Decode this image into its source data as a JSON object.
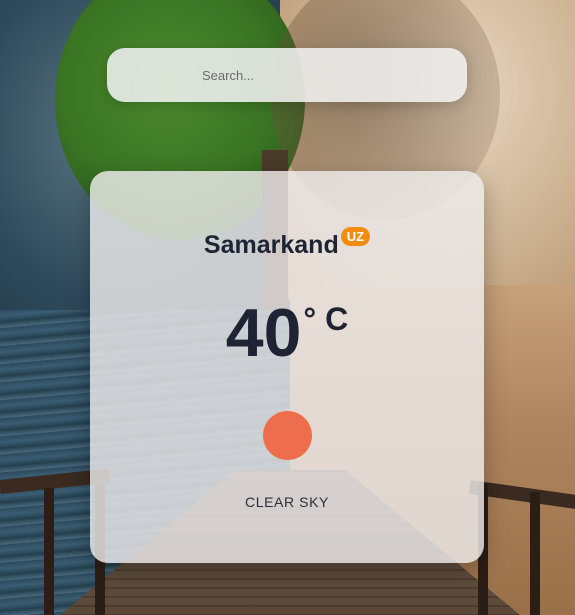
{
  "search": {
    "placeholder": "Search..."
  },
  "weather": {
    "city": "Samarkand",
    "country": "UZ",
    "temperature": "40",
    "unit": "° C",
    "condition": "CLEAR SKY",
    "icon": "sun-icon"
  },
  "colors": {
    "badge": "#f28c0f",
    "sun": "#ee6d4c",
    "text": "#1e2434"
  }
}
